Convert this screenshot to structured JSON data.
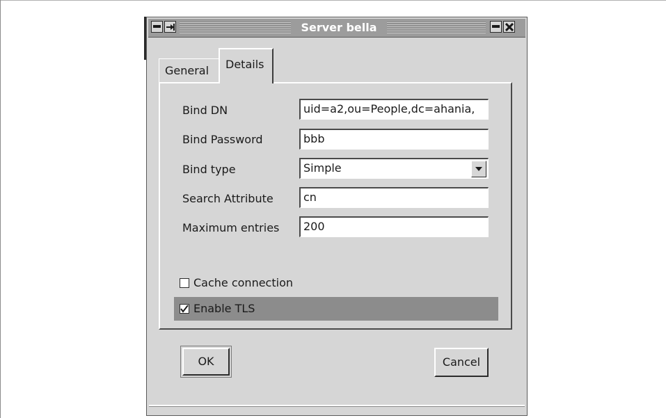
{
  "window": {
    "title": "Server bella"
  },
  "tabs": [
    {
      "label": "General",
      "active": false
    },
    {
      "label": "Details",
      "active": true
    }
  ],
  "fields": {
    "bind_dn": {
      "label": "Bind DN",
      "value": "uid=a2,ou=People,dc=ahania,"
    },
    "bind_password": {
      "label": "Bind Password",
      "value": "bbb"
    },
    "bind_type": {
      "label": "Bind type",
      "value": "Simple"
    },
    "search_attribute": {
      "label": "Search Attribute",
      "value": "cn"
    },
    "maximum_entries": {
      "label": "Maximum entries",
      "value": "200"
    }
  },
  "checkboxes": {
    "cache_connection": {
      "label": "Cache connection",
      "checked": false
    },
    "enable_tls": {
      "label": "Enable TLS",
      "checked": true
    }
  },
  "buttons": {
    "ok_label": "OK",
    "cancel_label": "Cancel"
  }
}
